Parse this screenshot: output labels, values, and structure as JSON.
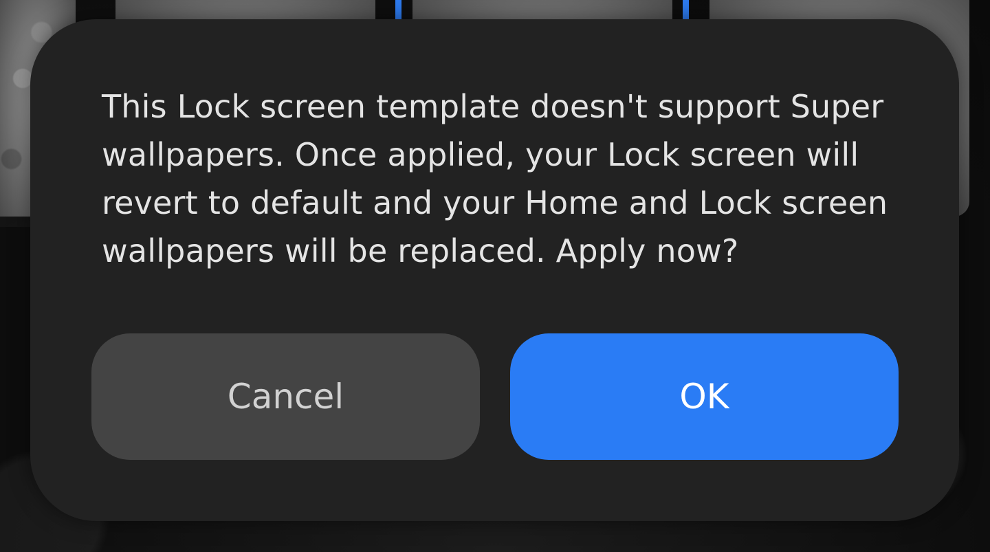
{
  "dialog": {
    "message": "This Lock screen template doesn't support Super wallpapers. Once applied, your Lock screen will revert to default and your Home and Lock screen wallpapers will be replaced. Apply now?",
    "cancel_label": "Cancel",
    "ok_label": "OK"
  },
  "colors": {
    "dialog_background": "#222222",
    "cancel_button": "#444444",
    "ok_button": "#2a7cf5",
    "accent": "#2d7bf0"
  }
}
